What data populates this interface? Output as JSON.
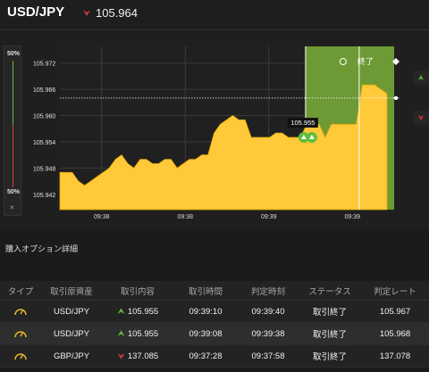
{
  "header": {
    "pair": "USD/JPY",
    "price": "105.964"
  },
  "colors": {
    "area_fill": "#ffc93a",
    "area_edge": "#e8a800",
    "win_zone": "#6d9a34",
    "up": "#5fbf3a",
    "down": "#d13c3c",
    "grid": "#3a3a3a"
  },
  "ratio": {
    "top_label": "50%",
    "bottom_label": "50%",
    "close_symbol": "×"
  },
  "chart_data": {
    "type": "area",
    "y_ticks": [
      "105.972",
      "105.966",
      "105.960",
      "105.954",
      "105.948",
      "105.942"
    ],
    "y_tick_values": [
      105.972,
      105.966,
      105.96,
      105.954,
      105.948,
      105.942
    ],
    "ylim": [
      105.9385,
      105.9758
    ],
    "x_ticks": [
      "09:38",
      "09:38",
      "09:39",
      "09:39"
    ],
    "entry_label": "105.955",
    "entry_level": 105.955,
    "current_level": 105.964,
    "zone_label": "終了",
    "zone_icon": "timer-icon",
    "series": [
      {
        "values": [
          105.947,
          105.947,
          105.947,
          105.945,
          105.944,
          105.945,
          105.946,
          105.947,
          105.948,
          105.95,
          105.951,
          105.949,
          105.948,
          105.95,
          105.95,
          105.949,
          105.949,
          105.95,
          105.95,
          105.948,
          105.949,
          105.95,
          105.95,
          105.951,
          105.951,
          105.956,
          105.958,
          105.959,
          105.96,
          105.959,
          105.959,
          105.955,
          105.955,
          105.955,
          105.955,
          105.956,
          105.956,
          105.955,
          105.955,
          105.955,
          105.958,
          105.958,
          105.958,
          105.955,
          105.958,
          105.958,
          105.958,
          105.958,
          105.958,
          105.967,
          105.967,
          105.967,
          105.966,
          105.965
        ]
      }
    ]
  },
  "section": {
    "title": "購入オプション詳細"
  },
  "table": {
    "headers": [
      "タイプ",
      "取引原資産",
      "取引内容",
      "取引時間",
      "判定時刻",
      "ステータス",
      "判定レート"
    ],
    "rows": [
      {
        "type_icon": "gauge-icon",
        "asset": "USD/JPY",
        "direction": "up",
        "direction_icon": "arrow-up-icon",
        "rate": "105.955",
        "trade_time": "09:39:10",
        "judge_time": "09:39:40",
        "status": "取引終了",
        "judge_rate": "105.967"
      },
      {
        "type_icon": "gauge-icon",
        "asset": "USD/JPY",
        "direction": "up",
        "direction_icon": "arrow-up-icon",
        "rate": "105.955",
        "trade_time": "09:39:08",
        "judge_time": "09:39:38",
        "status": "取引終了",
        "judge_rate": "105.968"
      },
      {
        "type_icon": "gauge-icon",
        "asset": "GBP/JPY",
        "direction": "down",
        "direction_icon": "arrow-down-icon",
        "rate": "137.085",
        "trade_time": "09:37:28",
        "judge_time": "09:37:58",
        "status": "取引終了",
        "judge_rate": "137.078"
      }
    ]
  }
}
